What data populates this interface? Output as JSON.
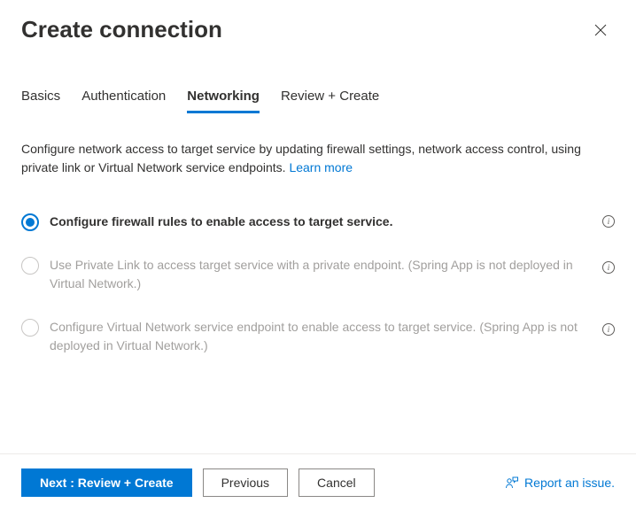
{
  "header": {
    "title": "Create connection"
  },
  "tabs": [
    {
      "label": "Basics",
      "active": false
    },
    {
      "label": "Authentication",
      "active": false
    },
    {
      "label": "Networking",
      "active": true
    },
    {
      "label": "Review + Create",
      "active": false
    }
  ],
  "content": {
    "description": "Configure network access to target service by updating firewall settings, network access control, using private link or Virtual Network service endpoints.",
    "learn_more_label": "Learn more"
  },
  "options": [
    {
      "label": "Configure firewall rules to enable access to target service.",
      "selected": true,
      "disabled": false,
      "has_info": true,
      "info_position": "inline"
    },
    {
      "label": "Use Private Link to access target service with a private endpoint. (Spring App is not deployed in Virtual Network.)",
      "selected": false,
      "disabled": true,
      "has_info": true,
      "info_position": "right"
    },
    {
      "label": "Configure Virtual Network service endpoint to enable access to target service. (Spring App is not deployed in Virtual Network.)",
      "selected": false,
      "disabled": true,
      "has_info": true,
      "info_position": "right"
    }
  ],
  "footer": {
    "primary_label": "Next : Review + Create",
    "previous_label": "Previous",
    "cancel_label": "Cancel",
    "report_label": "Report an issue."
  }
}
